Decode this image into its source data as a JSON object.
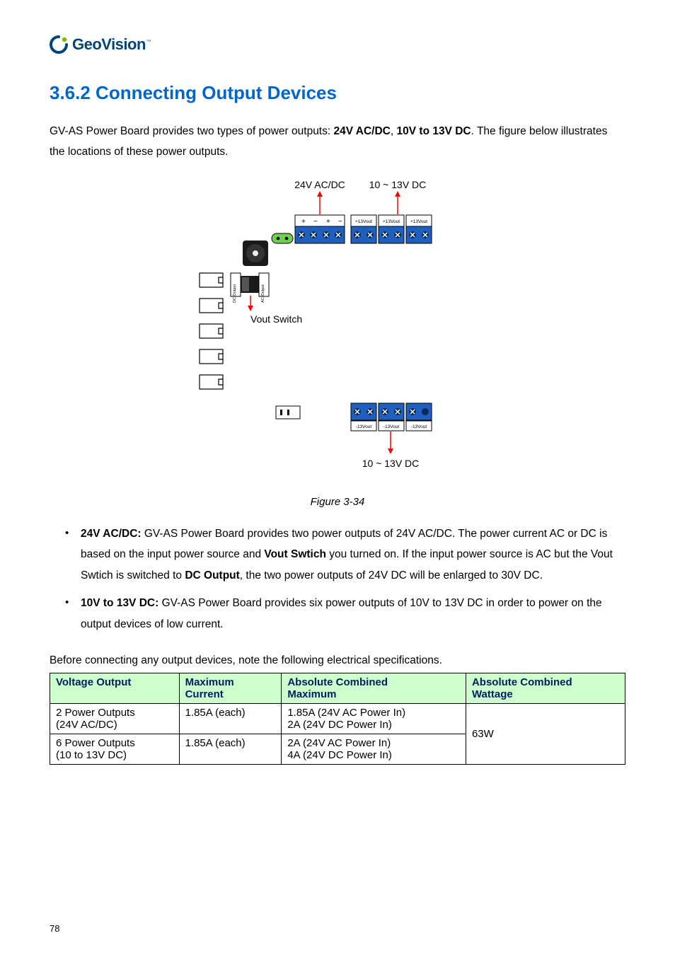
{
  "logo": {
    "text": "GeoVision"
  },
  "heading": "3.6.2  Connecting Output Devices",
  "intro": "GV-AS Power Board provides two types of power outputs: <strong>24V AC/DC</strong>, <strong>10V to 13V DC</strong>. The figure below illustrates the locations of these power outputs.",
  "figure": {
    "top_left_label": "24V AC/DC",
    "top_right_label": "10 ~ 13V DC",
    "vout_label": "Vout Switch",
    "bottom_label": "10 ~ 13V DC",
    "dc_output": "DC Output",
    "ac_output": "AC Output",
    "plus": "+",
    "minus": "−",
    "p13v": "+13Vout",
    "n13v": "-13Vout",
    "pm": "+  −"
  },
  "figcaption": "Figure 3-34",
  "bullets": [
    "<strong>24V AC/DC:</strong> GV-AS Power Board provides two power outputs of 24V AC/DC. The power current AC or DC is based on the input power source and <strong>Vout Swtich</strong> you turned on. If the input power source is AC but the Vout Swtich is switched to <strong>DC Output</strong>, the two power outputs of 24V DC will be enlarged to 30V DC.",
    "<strong>10V to 13V DC:</strong> GV-AS Power Board provides six power outputs of 10V to 13V DC in order to power on the output devices of low current."
  ],
  "table_intro": "Before connecting any output devices, note the following electrical specifications.",
  "table": {
    "head": {
      "c1": "Voltage Output",
      "c2a": "Maximum",
      "c2b": "Current",
      "c3a": "Absolute Combined",
      "c3b": "Maximum",
      "c4a": "Absolute Combined",
      "c4b": "Wattage"
    },
    "rows": [
      {
        "c1a": "2 Power Outputs",
        "c1b": "(24V AC/DC)",
        "c2": "1.85A (each)",
        "c3a": "1.85A (24V AC Power In)",
        "c3b": "2A (24V DC Power In)"
      },
      {
        "c1a": "6 Power Outputs",
        "c1b": "(10 to 13V DC)",
        "c2": "1.85A (each)",
        "c3a": "2A  (24V AC Power In)",
        "c3b": "4A  (24V DC Power In)"
      }
    ],
    "wattage": "63W"
  },
  "pagenum": "78"
}
